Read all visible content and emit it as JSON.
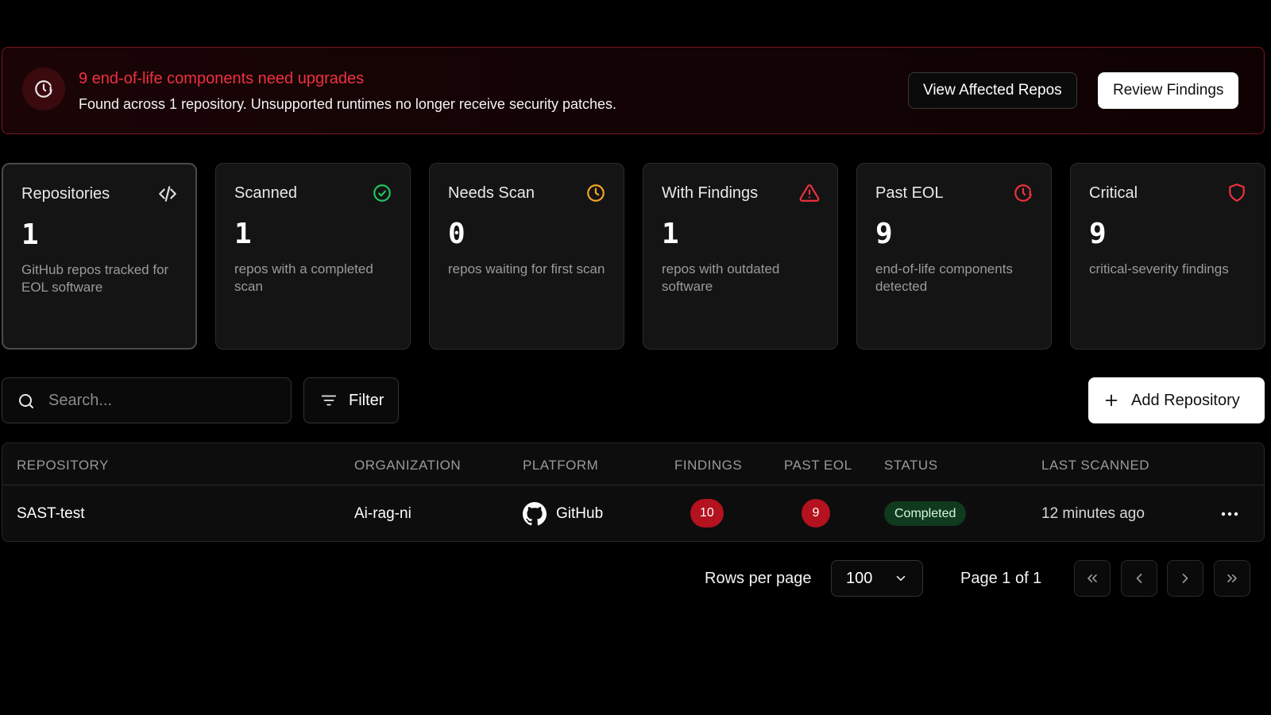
{
  "alert": {
    "title": "9 end-of-life components need upgrades",
    "description": "Found across 1 repository. Unsupported runtimes no longer receive security patches.",
    "view_button": "View Affected Repos",
    "review_button": "Review Findings",
    "icon": "clock-alert-icon",
    "color": "#ef3040"
  },
  "stats": [
    {
      "label": "Repositories",
      "value": "1",
      "description": "GitHub repos tracked for EOL software",
      "icon": "code-icon",
      "color": "#e0e0e0"
    },
    {
      "label": "Scanned",
      "value": "1",
      "description": "repos with a completed scan",
      "icon": "check-circle-icon",
      "color": "#22c55e"
    },
    {
      "label": "Needs Scan",
      "value": "0",
      "description": "repos waiting for first scan",
      "icon": "clock-icon",
      "color": "#f5a623"
    },
    {
      "label": "With Findings",
      "value": "1",
      "description": "repos with outdated software",
      "icon": "warning-triangle-icon",
      "color": "#ef3040"
    },
    {
      "label": "Past EOL",
      "value": "9",
      "description": "end-of-life components detected",
      "icon": "clock-alert-icon",
      "color": "#ef3040"
    },
    {
      "label": "Critical",
      "value": "9",
      "description": "critical-severity findings",
      "icon": "shield-icon",
      "color": "#ef3040"
    }
  ],
  "toolbar": {
    "search_placeholder": "Search...",
    "filter_label": "Filter",
    "add_label": "Add Repository"
  },
  "table": {
    "columns": [
      "REPOSITORY",
      "ORGANIZATION",
      "PLATFORM",
      "FINDINGS",
      "PAST EOL",
      "STATUS",
      "LAST SCANNED"
    ],
    "rows": [
      {
        "repository": "SAST-test",
        "organization": "Ai-rag-ni",
        "platform": "GitHub",
        "findings": "10",
        "past_eol": "9",
        "status": "Completed",
        "last_scanned": "12 minutes ago"
      }
    ]
  },
  "pagination": {
    "rows_label": "Rows per page",
    "rows_value": "100",
    "page_label": "Page 1 of 1"
  }
}
